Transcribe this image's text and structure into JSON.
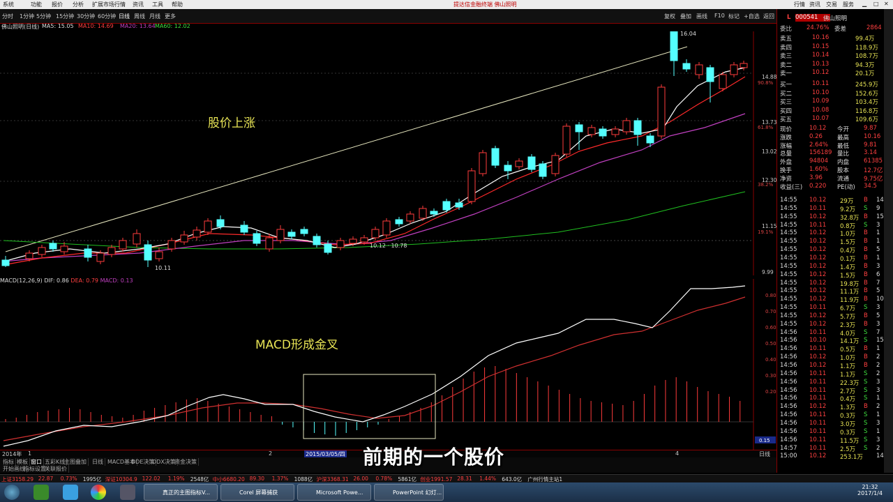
{
  "menubar": {
    "items": [
      "系统",
      "功能",
      "报价",
      "分析",
      "扩展市场行情",
      "资讯",
      "工具",
      "帮助"
    ],
    "center_text": "提达信金融终端  佛山照明",
    "right_items": [
      "行情",
      "资讯",
      "交易",
      "服务"
    ]
  },
  "toolbar": {
    "periods": [
      "分时",
      "1分钟",
      "5分钟",
      "15分钟",
      "30分钟",
      "60分钟",
      "日线",
      "周线",
      "月线",
      "更多"
    ],
    "right_items": [
      "复权",
      "叠加",
      "画线",
      "F10",
      "标记",
      "+自选",
      "返回"
    ]
  },
  "chart_info": {
    "label": "佛山照明(日线)",
    "ma5": "MA5: 15.05",
    "ma10": "MA10: 14.69",
    "ma20": "MA20: 13.64",
    "ma60": "MA60: 12.02"
  },
  "main_price_axis": [
    "14.88",
    "13.73",
    "13.02",
    "12.30",
    "11.15",
    "9.99"
  ],
  "main_pct_axis": [
    "90.8%",
    "61.8%",
    "38.2%",
    "19.1%"
  ],
  "annotations": {
    "price_rise": "股价上涨",
    "macd_cross": "MACD形成金叉",
    "high_label": "16.04",
    "low_label": "10.11",
    "mid_label": "10.12 · 10.78"
  },
  "macd_info": {
    "label": "MACD(12,26,9)",
    "dif": "DIF: 0.86",
    "dea": "DEA: 0.79",
    "macd": "MACD: 0.13"
  },
  "macd_axis": [
    "0.80",
    "0.70",
    "0.60",
    "0.50",
    "0.40",
    "0.30",
    "0.20"
  ],
  "macd_badge": "0.15",
  "xbar": {
    "start": "2014年",
    "one": "1",
    "two": "2",
    "date_box": "2015/03/05/四",
    "four": "4",
    "right": "日线"
  },
  "bottom_tabs": [
    "指标",
    "模板",
    "窗口",
    "五彩K线",
    "主图叠加",
    "日线",
    "MACD基本",
    "DDE决策",
    "DDX决策",
    "资金决策"
  ],
  "bottom_tabs_row2": [
    "开始画线",
    "指标设置",
    "关联报价"
  ],
  "subtitle": "前期的一个股价",
  "stock": {
    "code": "000541",
    "name": "佛山照明",
    "marker": "L",
    "weibi_label": "委比",
    "weibi": "24.76%",
    "weicha_label": "委差",
    "weicha": "2864"
  },
  "order_book": {
    "asks": [
      {
        "label": "卖五",
        "price": "10.16",
        "vol": "99.4万"
      },
      {
        "label": "卖四",
        "price": "10.15",
        "vol": "118.9万"
      },
      {
        "label": "卖三",
        "price": "10.14",
        "vol": "108.7万"
      },
      {
        "label": "卖二",
        "price": "10.13",
        "vol": "94.3万"
      },
      {
        "label": "卖一",
        "price": "10.12",
        "vol": "20.1万"
      }
    ],
    "bids": [
      {
        "label": "买一",
        "price": "10.11",
        "vol": "245.9万"
      },
      {
        "label": "买二",
        "price": "10.10",
        "vol": "152.6万"
      },
      {
        "label": "买三",
        "price": "10.09",
        "vol": "103.4万"
      },
      {
        "label": "买四",
        "price": "10.08",
        "vol": "116.8万"
      },
      {
        "label": "买五",
        "price": "10.07",
        "vol": "109.6万"
      }
    ]
  },
  "quote": [
    {
      "l1": "现价",
      "v1": "10.12",
      "l2": "今开",
      "v2": "9.87"
    },
    {
      "l1": "涨跌",
      "v1": "0.26",
      "l2": "最高",
      "v2": "10.16"
    },
    {
      "l1": "涨幅",
      "v1": "2.64%",
      "l2": "最低",
      "v2": "9.81"
    },
    {
      "l1": "总量",
      "v1": "156189",
      "l2": "量比",
      "v2": "3.14"
    },
    {
      "l1": "外盘",
      "v1": "94804",
      "l2": "内盘",
      "v2": "61385"
    },
    {
      "l1": "换手",
      "v1": "1.60%",
      "l2": "股本",
      "v2": "12.7亿"
    },
    {
      "l1": "净资",
      "v1": "3.96",
      "l2": "流通",
      "v2": "9.75亿"
    },
    {
      "l1": "收益(三)",
      "v1": "0.220",
      "l2": "PE(动)",
      "v2": "34.5"
    }
  ],
  "ticks": [
    {
      "t": "14:55",
      "p": "10.12",
      "v": "29万",
      "d": "B",
      "n": "14"
    },
    {
      "t": "14:55",
      "p": "10.11",
      "v": "9.2万",
      "d": "S",
      "n": "9"
    },
    {
      "t": "14:55",
      "p": "10.12",
      "v": "32.8万",
      "d": "B",
      "n": "15"
    },
    {
      "t": "14:55",
      "p": "10.11",
      "v": "0.8万",
      "d": "S",
      "n": "3"
    },
    {
      "t": "14:55",
      "p": "10.12",
      "v": "1.0万",
      "d": "B",
      "n": "1"
    },
    {
      "t": "14:55",
      "p": "10.12",
      "v": "1.5万",
      "d": "B",
      "n": "1"
    },
    {
      "t": "14:55",
      "p": "10.12",
      "v": "0.4万",
      "d": "B",
      "n": "5"
    },
    {
      "t": "14:55",
      "p": "10.12",
      "v": "0.1万",
      "d": "B",
      "n": "1"
    },
    {
      "t": "14:55",
      "p": "10.12",
      "v": "1.4万",
      "d": "B",
      "n": "3"
    },
    {
      "t": "14:55",
      "p": "10.12",
      "v": "1.5万",
      "d": "B",
      "n": "6"
    },
    {
      "t": "14:55",
      "p": "10.12",
      "v": "19.8万",
      "d": "B",
      "n": "7"
    },
    {
      "t": "14:55",
      "p": "10.12",
      "v": "11.1万",
      "d": "B",
      "n": "5"
    },
    {
      "t": "14:55",
      "p": "10.12",
      "v": "11.9万",
      "d": "B",
      "n": "10"
    },
    {
      "t": "14:55",
      "p": "10.11",
      "v": "6.7万",
      "d": "S",
      "n": "3"
    },
    {
      "t": "14:55",
      "p": "10.12",
      "v": "5.7万",
      "d": "B",
      "n": "5"
    },
    {
      "t": "14:55",
      "p": "10.12",
      "v": "2.3万",
      "d": "B",
      "n": "3"
    },
    {
      "t": "14:56",
      "p": "10.11",
      "v": "4.0万",
      "d": "S",
      "n": "7"
    },
    {
      "t": "14:56",
      "p": "10.10",
      "v": "14.1万",
      "d": "S",
      "n": "15"
    },
    {
      "t": "14:56",
      "p": "10.11",
      "v": "0.5万",
      "d": "B",
      "n": "1"
    },
    {
      "t": "14:56",
      "p": "10.12",
      "v": "1.0万",
      "d": "B",
      "n": "2"
    },
    {
      "t": "14:56",
      "p": "10.12",
      "v": "1.1万",
      "d": "B",
      "n": "2"
    },
    {
      "t": "14:56",
      "p": "10.11",
      "v": "1.1万",
      "d": "S",
      "n": "2"
    },
    {
      "t": "14:56",
      "p": "10.11",
      "v": "22.3万",
      "d": "S",
      "n": "3"
    },
    {
      "t": "14:56",
      "p": "10.11",
      "v": "2.7万",
      "d": "S",
      "n": "3"
    },
    {
      "t": "14:56",
      "p": "10.11",
      "v": "0.4万",
      "d": "S",
      "n": "1"
    },
    {
      "t": "14:56",
      "p": "10.12",
      "v": "1.3万",
      "d": "B",
      "n": "2"
    },
    {
      "t": "14:56",
      "p": "10.11",
      "v": "0.3万",
      "d": "S",
      "n": "1"
    },
    {
      "t": "14:56",
      "p": "10.11",
      "v": "3.0万",
      "d": "S",
      "n": "3"
    },
    {
      "t": "14:56",
      "p": "10.11",
      "v": "0.3万",
      "d": "S",
      "n": "1"
    },
    {
      "t": "14:56",
      "p": "10.11",
      "v": "11.5万",
      "d": "S",
      "n": "3"
    },
    {
      "t": "14:57",
      "p": "10.11",
      "v": "2.5万",
      "d": "S",
      "n": "2"
    },
    {
      "t": "15:00",
      "p": "10.12",
      "v": "253.1万",
      "d": "",
      "n": "144"
    }
  ],
  "ticker_bar": [
    {
      "text": "上证3158.29",
      "color": "red"
    },
    {
      "text": "22.87",
      "color": "red"
    },
    {
      "text": "0.73%",
      "color": "red"
    },
    {
      "text": "1995亿",
      "color": "wht"
    },
    {
      "text": "深证10304.9",
      "color": "red"
    },
    {
      "text": "122.02",
      "color": "red"
    },
    {
      "text": "1.19%",
      "color": "red"
    },
    {
      "text": "2548亿",
      "color": "wht"
    },
    {
      "text": "中小6680.20",
      "color": "red"
    },
    {
      "text": "89.30",
      "color": "red"
    },
    {
      "text": "1.37%",
      "color": "red"
    },
    {
      "text": "1088亿",
      "color": "wht"
    },
    {
      "text": "沪深3368.31",
      "color": "red"
    },
    {
      "text": "26.00",
      "color": "red"
    },
    {
      "text": "0.78%",
      "color": "red"
    },
    {
      "text": "5861亿",
      "color": "wht"
    },
    {
      "text": "创业1991.57",
      "color": "red"
    },
    {
      "text": "28.31",
      "color": "red"
    },
    {
      "text": "1.44%",
      "color": "red"
    },
    {
      "text": "643.0亿",
      "color": "wht"
    },
    {
      "text": "广州行情主站1",
      "color": "wht"
    }
  ],
  "taskbar": {
    "tasks": [
      "真正的主图指标V...",
      "Corel 屏幕捕获",
      "Microsoft Powe...",
      "PowerPoint 幻灯..."
    ],
    "time": "21:32",
    "date": "2017/1/4"
  },
  "colors": {
    "up": "#ff3b3b",
    "down": "#54ffff",
    "ma5": "#ffffff",
    "ma10": "#ff2a2a",
    "ma20": "#c040c0",
    "ma60": "#20c020",
    "annotation": "#e8e455"
  }
}
